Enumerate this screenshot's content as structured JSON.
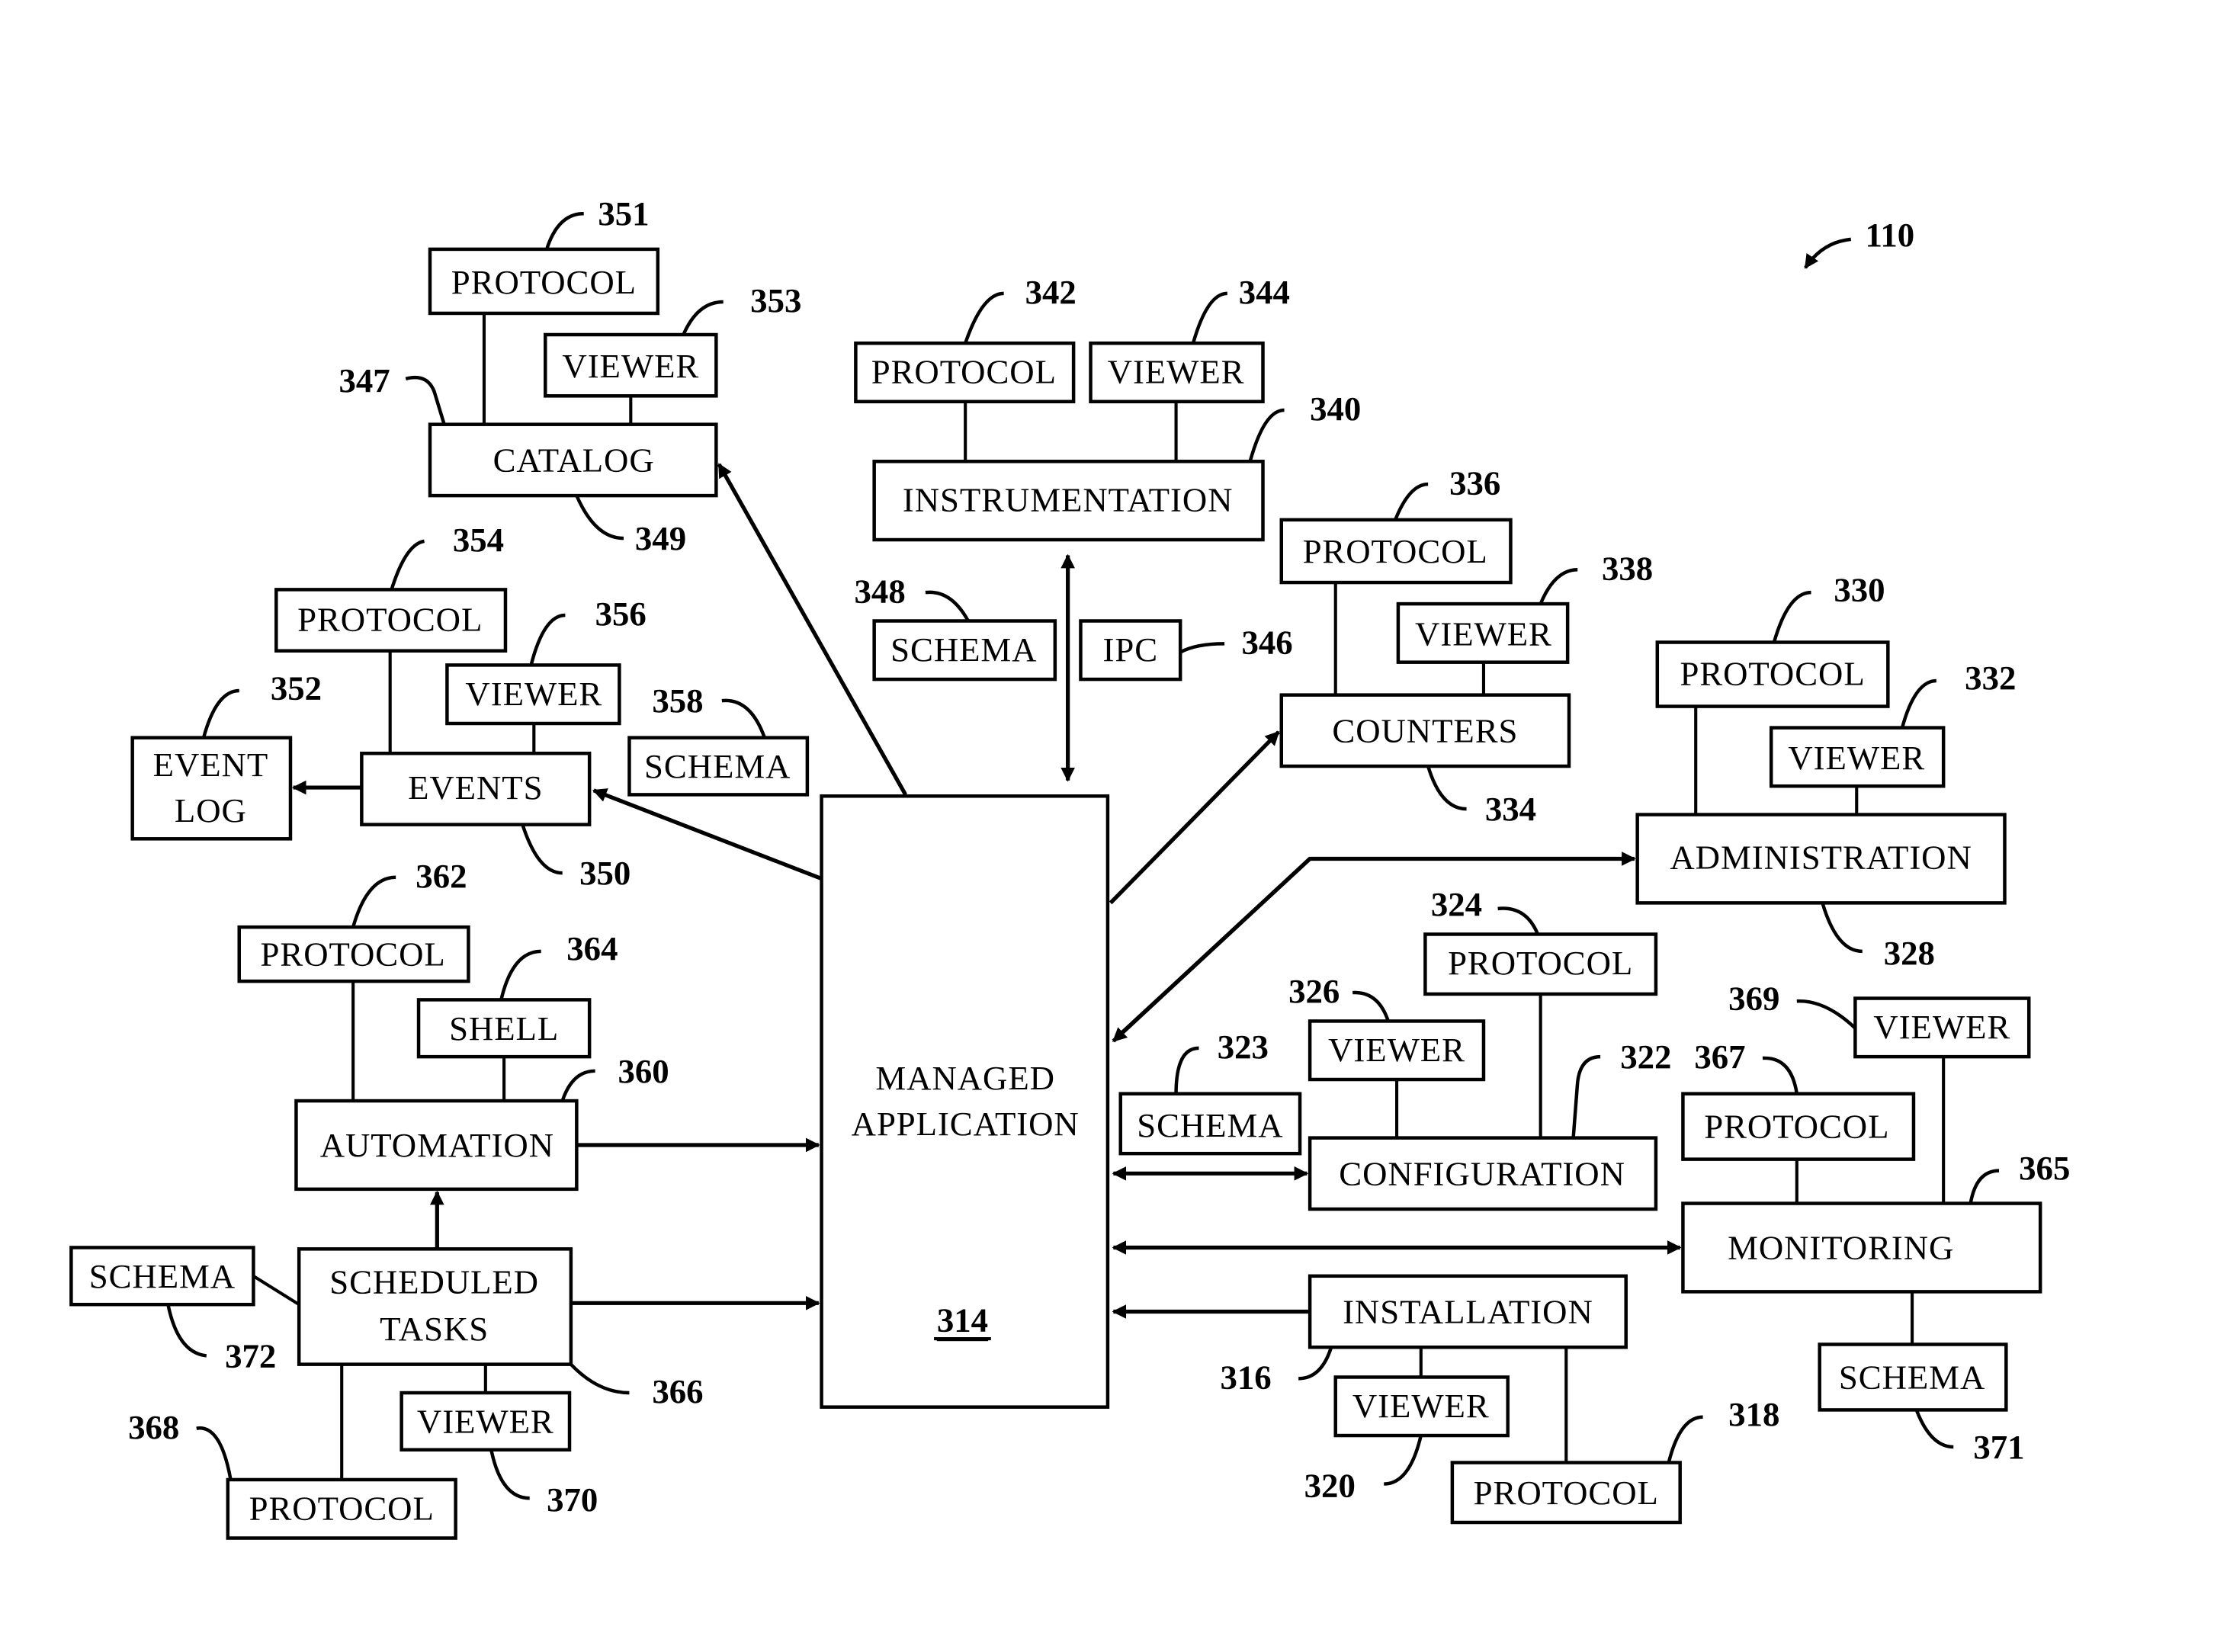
{
  "figure_ref": "110",
  "center": {
    "label_lines": [
      "MANAGED",
      "APPLICATION"
    ],
    "ref": "314"
  },
  "boxes": {
    "catalog": "CATALOG",
    "catalog_protocol": "PROTOCOL",
    "catalog_viewer": "VIEWER",
    "events": "EVENTS",
    "events_protocol": "PROTOCOL",
    "events_viewer": "VIEWER",
    "events_schema": "SCHEMA",
    "event_log_1": "EVENT",
    "event_log_2": "LOG",
    "automation": "AUTOMATION",
    "automation_protocol": "PROTOCOL",
    "automation_shell": "SHELL",
    "scheduled_1": "SCHEDULED",
    "scheduled_2": "TASKS",
    "scheduled_schema": "SCHEMA",
    "scheduled_viewer": "VIEWER",
    "scheduled_protocol": "PROTOCOL",
    "instrumentation": "INSTRUMENTATION",
    "instr_protocol": "PROTOCOL",
    "instr_viewer": "VIEWER",
    "instr_schema": "SCHEMA",
    "ipc": "IPC",
    "counters": "COUNTERS",
    "counters_protocol": "PROTOCOL",
    "counters_viewer": "VIEWER",
    "administration": "ADMINISTRATION",
    "admin_protocol": "PROTOCOL",
    "admin_viewer": "VIEWER",
    "configuration": "CONFIGURATION",
    "config_protocol": "PROTOCOL",
    "config_viewer": "VIEWER",
    "config_schema": "SCHEMA",
    "monitoring": "MONITORING",
    "monitor_protocol": "PROTOCOL",
    "monitor_viewer": "VIEWER",
    "monitor_schema": "SCHEMA",
    "installation": "INSTALLATION",
    "install_viewer": "VIEWER",
    "install_protocol": "PROTOCOL"
  },
  "refs": {
    "r351": "351",
    "r353": "353",
    "r347": "347",
    "r349": "349",
    "r354": "354",
    "r356": "356",
    "r352": "352",
    "r358": "358",
    "r350": "350",
    "r362": "362",
    "r364": "364",
    "r360": "360",
    "r372": "372",
    "r366": "366",
    "r368": "368",
    "r370": "370",
    "r342": "342",
    "r344": "344",
    "r340": "340",
    "r348": "348",
    "r346": "346",
    "r336": "336",
    "r338": "338",
    "r334": "334",
    "r330": "330",
    "r332": "332",
    "r328": "328",
    "r324": "324",
    "r326": "326",
    "r323": "323",
    "r322": "322",
    "r367": "367",
    "r369": "369",
    "r365": "365",
    "r371": "371",
    "r316": "316",
    "r320": "320",
    "r318": "318"
  }
}
